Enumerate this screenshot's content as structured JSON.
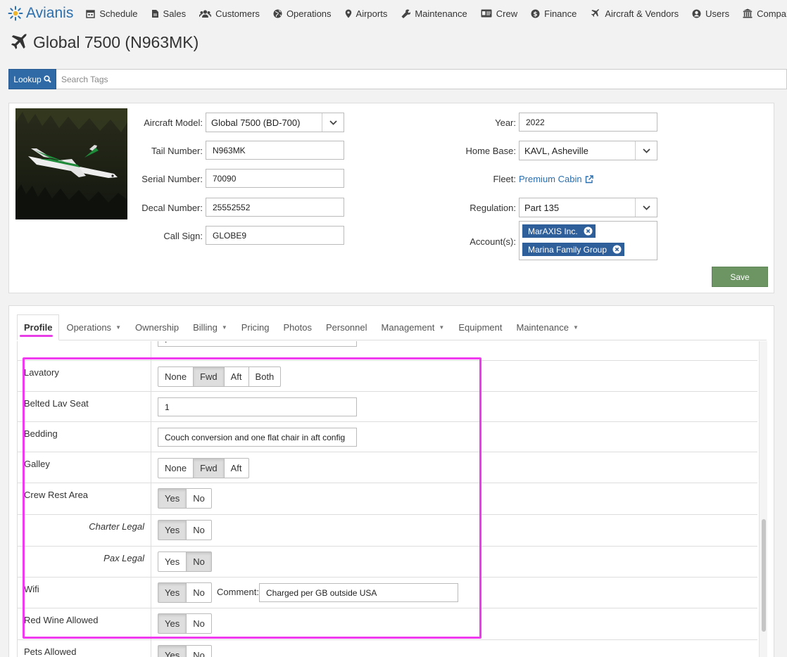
{
  "app": {
    "logo_text": "Avianis",
    "brand_color": "#2c6fad",
    "nav": [
      {
        "label": "Schedule",
        "icon": "calendar-icon"
      },
      {
        "label": "Sales",
        "icon": "document-icon"
      },
      {
        "label": "Customers",
        "icon": "users-group-icon"
      },
      {
        "label": "Operations",
        "icon": "globe-icon"
      },
      {
        "label": "Airports",
        "icon": "map-pin-icon"
      },
      {
        "label": "Maintenance",
        "icon": "wrench-icon"
      },
      {
        "label": "Crew",
        "icon": "id-card-icon"
      },
      {
        "label": "Finance",
        "icon": "dollar-icon"
      },
      {
        "label": "Aircraft & Vendors",
        "icon": "plane-icon"
      },
      {
        "label": "Users",
        "icon": "user-circle-icon"
      },
      {
        "label": "Company",
        "icon": "building-icon"
      }
    ]
  },
  "page": {
    "title": "Global 7500 (N963MK)",
    "title_icon": "plane-icon"
  },
  "lookup": {
    "button_label": "Lookup",
    "placeholder": "Search Tags"
  },
  "aircraft": {
    "model_label": "Aircraft Model:",
    "model_value": "Global 7500 (BD-700)",
    "tail_label": "Tail Number:",
    "tail_value": "N963MK",
    "serial_label": "Serial Number:",
    "serial_value": "70090",
    "decal_label": "Decal Number:",
    "decal_value": "25552552",
    "callsign_label": "Call Sign:",
    "callsign_value": "GLOBE9",
    "year_label": "Year:",
    "year_value": "2022",
    "homebase_label": "Home Base:",
    "homebase_value": "KAVL, Asheville",
    "fleet_label": "Fleet:",
    "fleet_value": "Premium Cabin",
    "regulation_label": "Regulation:",
    "regulation_value": "Part 135",
    "accounts_label": "Account(s):",
    "accounts": [
      "MarAXIS Inc.",
      "Marina Family Group"
    ],
    "save_label": "Save"
  },
  "tabs": [
    {
      "label": "Profile",
      "dropdown": false,
      "active": true
    },
    {
      "label": "Operations",
      "dropdown": true
    },
    {
      "label": "Ownership",
      "dropdown": false
    },
    {
      "label": "Billing",
      "dropdown": true
    },
    {
      "label": "Pricing",
      "dropdown": false
    },
    {
      "label": "Photos",
      "dropdown": false
    },
    {
      "label": "Personnel",
      "dropdown": false
    },
    {
      "label": "Management",
      "dropdown": true
    },
    {
      "label": "Equipment",
      "dropdown": false
    },
    {
      "label": "Maintenance",
      "dropdown": true
    }
  ],
  "profile_rows": {
    "lavatory": {
      "label": "Lavatory",
      "options": [
        "None",
        "Fwd",
        "Aft",
        "Both"
      ],
      "selected": "Fwd"
    },
    "belted_lav_seat": {
      "label": "Belted Lav Seat",
      "value": "1"
    },
    "bedding": {
      "label": "Bedding",
      "value": "Couch conversion and one flat chair in aft config"
    },
    "galley": {
      "label": "Galley",
      "options": [
        "None",
        "Fwd",
        "Aft"
      ],
      "selected": "Fwd"
    },
    "crew_rest": {
      "label": "Crew Rest Area",
      "options": [
        "Yes",
        "No"
      ],
      "selected": "Yes"
    },
    "charter_legal": {
      "label": "Charter Legal",
      "options": [
        "Yes",
        "No"
      ],
      "selected": "Yes"
    },
    "pax_legal": {
      "label": "Pax Legal",
      "options": [
        "Yes",
        "No"
      ],
      "selected": "No"
    },
    "wifi": {
      "label": "Wifi",
      "options": [
        "Yes",
        "No"
      ],
      "selected": "Yes",
      "comment_label": "Comment:",
      "comment_value": "Charged per GB outside USA"
    },
    "red_wine": {
      "label": "Red Wine Allowed",
      "options": [
        "Yes",
        "No"
      ],
      "selected": "Yes"
    },
    "pets": {
      "label": "Pets Allowed",
      "options": [
        "Yes",
        "No"
      ],
      "selected": "Yes"
    }
  },
  "colors": {
    "primary_button": "#2f6aa7",
    "save_button": "#6c9563",
    "tag": "#2f5f9a",
    "highlight": "#f03af0"
  }
}
